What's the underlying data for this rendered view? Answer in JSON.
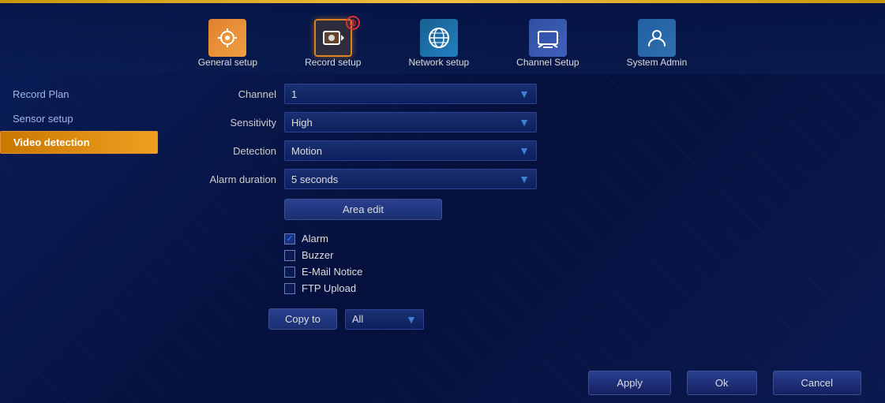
{
  "topbar": {
    "color": "#c8960c"
  },
  "nav": {
    "items": [
      {
        "id": "general",
        "label": "General setup",
        "icon": "🔧",
        "iconClass": "icon-general",
        "active": false,
        "badge": null
      },
      {
        "id": "record",
        "label": "Record setup",
        "icon": "📷",
        "iconClass": "icon-record",
        "active": true,
        "badge": "②"
      },
      {
        "id": "network",
        "label": "Network setup",
        "icon": "🌐",
        "iconClass": "icon-network",
        "active": false,
        "badge": null
      },
      {
        "id": "channel",
        "label": "Channel Setup",
        "icon": "📺",
        "iconClass": "icon-channel",
        "active": false,
        "badge": null
      },
      {
        "id": "system",
        "label": "System Admin",
        "icon": "⚙️",
        "iconClass": "icon-system",
        "active": false,
        "badge": null
      }
    ]
  },
  "sidebar": {
    "groups": [
      {
        "label": "Record Plan",
        "items": []
      },
      {
        "label": "Sensor setup",
        "items": []
      },
      {
        "label": "",
        "items": [
          {
            "id": "video-detection",
            "label": "Video detection",
            "active": true
          }
        ]
      }
    ]
  },
  "form": {
    "fields": [
      {
        "id": "channel",
        "label": "Channel",
        "value": "1",
        "type": "dropdown"
      },
      {
        "id": "sensitivity",
        "label": "Sensitivity",
        "value": "High",
        "type": "dropdown"
      },
      {
        "id": "detection",
        "label": "Detection",
        "value": "Motion",
        "type": "dropdown"
      },
      {
        "id": "alarm_duration",
        "label": "Alarm duration",
        "value": "5 seconds",
        "type": "dropdown"
      }
    ],
    "area_edit_label": "Area edit",
    "checkboxes": [
      {
        "id": "alarm",
        "label": "Alarm",
        "checked": true
      },
      {
        "id": "buzzer",
        "label": "Buzzer",
        "checked": false
      },
      {
        "id": "email",
        "label": "E-Mail Notice",
        "checked": false
      },
      {
        "id": "ftp",
        "label": "FTP Upload",
        "checked": false
      }
    ],
    "copy_to": {
      "label": "Copy to",
      "value": "All"
    }
  },
  "buttons": {
    "apply": "Apply",
    "ok": "Ok",
    "cancel": "Cancel"
  }
}
